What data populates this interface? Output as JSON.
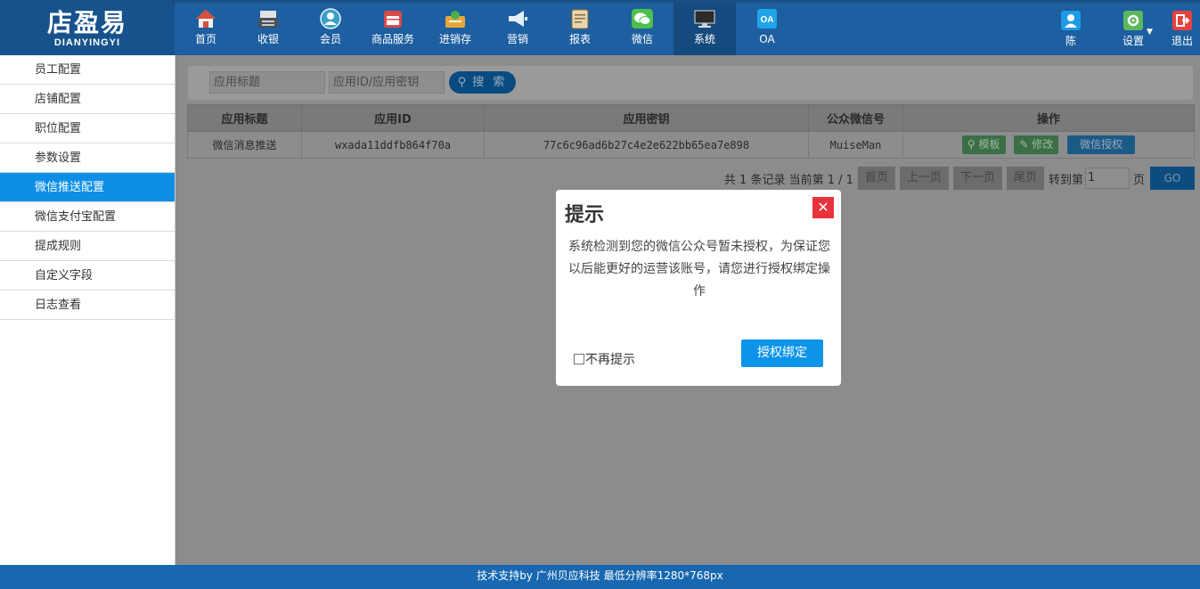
{
  "logo": {
    "main": "店盈易",
    "sub": "DIANYINGYI"
  },
  "nav": [
    {
      "label": "首页",
      "icon": "home-icon",
      "color": "#d94e3a"
    },
    {
      "label": "收银",
      "icon": "cashier-icon",
      "color": "#d0d4d8"
    },
    {
      "label": "会员",
      "icon": "member-icon",
      "color": "#3aa0c8"
    },
    {
      "label": "商品服务",
      "icon": "goods-icon",
      "color": "#d84a4a"
    },
    {
      "label": "进销存",
      "icon": "inventory-icon",
      "color": "#e7a63a"
    },
    {
      "label": "营销",
      "icon": "megaphone-icon",
      "color": "#e6eef5"
    },
    {
      "label": "报表",
      "icon": "report-icon",
      "color": "#e8d7b0"
    },
    {
      "label": "微信",
      "icon": "wechat-icon",
      "color": "#4cbf4c"
    },
    {
      "label": "系统",
      "icon": "monitor-icon",
      "color": "#2b2b2b"
    },
    {
      "label": "OA",
      "icon": "oa-icon",
      "color": "#21a3e8"
    }
  ],
  "user": {
    "name": "陈",
    "settings": "设置",
    "logout": "退出"
  },
  "sidebar": [
    "员工配置",
    "店铺配置",
    "职位配置",
    "参数设置",
    "微信推送配置",
    "微信支付宝配置",
    "提成规则",
    "自定义字段",
    "日志查看"
  ],
  "search": {
    "title_placeholder": "应用标题",
    "id_placeholder": "应用ID/应用密钥",
    "button": "搜 索"
  },
  "table": {
    "headers": [
      "应用标题",
      "应用ID",
      "应用密钥",
      "公众微信号",
      "操作"
    ],
    "rows": [
      {
        "title": "微信消息推送",
        "app_id": "wxada11ddfb864f70a",
        "secret": "77c6c96ad6b27c4e2e622bb65ea7e898",
        "wechat": "MuiseMan"
      }
    ],
    "actions": {
      "template": "模板",
      "edit": "修改",
      "auth": "微信授权"
    }
  },
  "pager": {
    "summary": "共 1 条记录 当前第 1 / 1",
    "first": "首页",
    "prev": "上一页",
    "next": "下一页",
    "last": "尾页",
    "goto": "转到第",
    "page_value": "1",
    "page_unit": "页",
    "go": "GO"
  },
  "modal": {
    "title": "提示",
    "close": "✕",
    "message": "系统检测到您的微信公众号暂未授权，为保证您以后能更好的运营该账号，请您进行授权绑定操作",
    "dont_show": "不再提示",
    "button": "授权绑定"
  },
  "footer": "技术支持by 广州贝应科技    最低分辨率1280*768px"
}
